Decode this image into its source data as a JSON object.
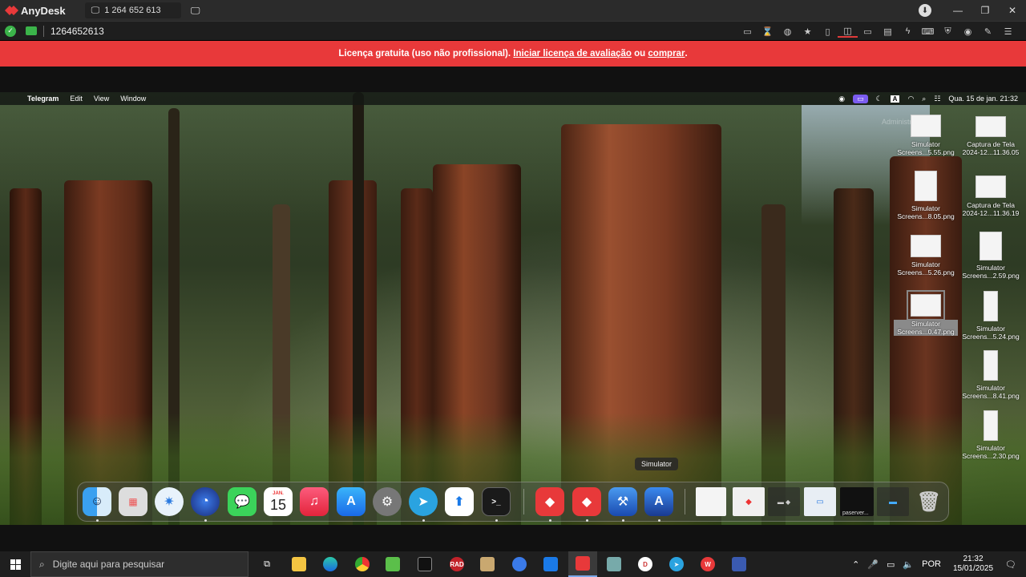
{
  "anydesk": {
    "app_name": "AnyDesk",
    "tab_id": "1 264 652 613",
    "address": "1264652613",
    "banner": {
      "prefix": "Licença gratuita (uso não profissional).",
      "link1": "Iniciar licença de avaliação",
      "mid": "ou",
      "link2": "comprar",
      "suffix": "."
    },
    "accent": "#e8393a"
  },
  "mac": {
    "menubar": {
      "app": "Telegram",
      "items": [
        "Edit",
        "View",
        "Window"
      ],
      "datetime": "Qua. 15 de jan.  21:32",
      "input_badge": "A"
    },
    "desktop_icons": [
      {
        "line1": "Simulator",
        "line2": "Screens...5.55.png"
      },
      {
        "line1": "Captura de Tela",
        "line2": "2024-12...11.36.05"
      },
      {
        "line1": "Simulator",
        "line2": "Screens...8.05.png"
      },
      {
        "line1": "Captura de Tela",
        "line2": "2024-12...11.36.19"
      },
      {
        "line1": "Simulator",
        "line2": "Screens...5.26.png"
      },
      {
        "line1": "Simulator",
        "line2": "Screens...2.59.png"
      },
      {
        "line1": "Simulator",
        "line2": "Screens...0.47.png"
      },
      {
        "line1": "Simulator",
        "line2": "Screens...5.24.png"
      },
      {
        "line1": "Simulator",
        "line2": "Screens...8.41.png"
      },
      {
        "line1": "Simulator",
        "line2": "Screens...2.30.png"
      }
    ],
    "desktop_watermark": "Administrator",
    "dock_tooltip": "Simulator",
    "dock": {
      "calendar_month": "JAN.",
      "calendar_day": "15",
      "terminal_glyph": ">_",
      "recent_label": "paserver..."
    }
  },
  "windows": {
    "search_placeholder": "Digite aqui para pesquisar",
    "rad_label": "RAD",
    "tray_lang": "POR",
    "time": "21:32",
    "date": "15/01/2025"
  }
}
